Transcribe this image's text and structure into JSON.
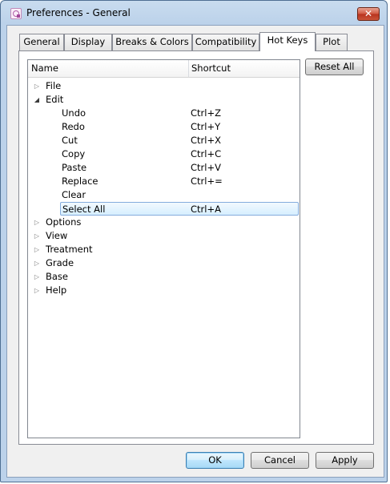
{
  "window": {
    "title": "Preferences - General",
    "close_glyph": "✕"
  },
  "tabs": [
    {
      "label": "General"
    },
    {
      "label": "Display"
    },
    {
      "label": "Breaks & Colors"
    },
    {
      "label": "Compatibility"
    },
    {
      "label": "Hot Keys",
      "active": true
    },
    {
      "label": "Plot"
    }
  ],
  "tree": {
    "columns": {
      "name": "Name",
      "shortcut": "Shortcut"
    },
    "rows": [
      {
        "label": "File",
        "shortcut": "",
        "expander": "▷"
      },
      {
        "label": "Edit",
        "shortcut": "",
        "expander": "◢"
      },
      {
        "label": "Undo",
        "shortcut": "Ctrl+Z"
      },
      {
        "label": "Redo",
        "shortcut": "Ctrl+Y"
      },
      {
        "label": "Cut",
        "shortcut": "Ctrl+X"
      },
      {
        "label": "Copy",
        "shortcut": "Ctrl+C"
      },
      {
        "label": "Paste",
        "shortcut": "Ctrl+V"
      },
      {
        "label": "Replace",
        "shortcut": "Ctrl+="
      },
      {
        "label": "Clear",
        "shortcut": ""
      },
      {
        "label": "Select All",
        "shortcut": "Ctrl+A",
        "selected": true
      },
      {
        "label": "Options",
        "shortcut": "",
        "expander": "▷"
      },
      {
        "label": "View",
        "shortcut": "",
        "expander": "▷"
      },
      {
        "label": "Treatment",
        "shortcut": "",
        "expander": "▷"
      },
      {
        "label": "Grade",
        "shortcut": "",
        "expander": "▷"
      },
      {
        "label": "Base",
        "shortcut": "",
        "expander": "▷"
      },
      {
        "label": "Help",
        "shortcut": "",
        "expander": "▷"
      }
    ]
  },
  "buttons": {
    "reset_all": "Reset All",
    "ok": "OK",
    "cancel": "Cancel",
    "apply": "Apply"
  },
  "colors": {
    "selection_border": "#84acdd",
    "selection_fill": "#d6efff",
    "close_button": "#c9543a"
  }
}
